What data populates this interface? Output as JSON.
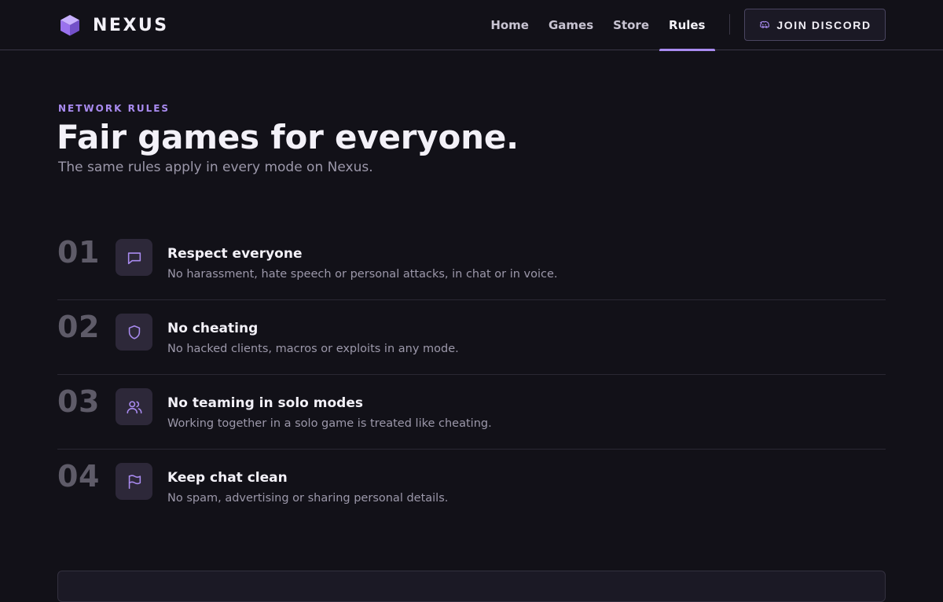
{
  "brand": {
    "name": "NEXUS",
    "accent": "#a98bf0"
  },
  "nav": {
    "items": [
      {
        "label": "Home",
        "active": false
      },
      {
        "label": "Games",
        "active": false
      },
      {
        "label": "Store",
        "active": false
      },
      {
        "label": "Rules",
        "active": true
      }
    ],
    "cta_label": "JOIN DISCORD",
    "cta_icon": "discord-icon"
  },
  "hero": {
    "eyebrow": "NETWORK RULES",
    "title": "Fair games for everyone.",
    "subtitle": "The same rules apply in every mode on Nexus."
  },
  "rules": [
    {
      "number": "01",
      "icon": "chat-bubble-icon",
      "title": "Respect everyone",
      "description": "No harassment, hate speech or personal attacks, in chat or in voice."
    },
    {
      "number": "02",
      "icon": "shield-icon",
      "title": "No cheating",
      "description": "No hacked clients, macros or exploits in any mode."
    },
    {
      "number": "03",
      "icon": "users-icon",
      "title": "No teaming in solo modes",
      "description": "Working together in a solo game is treated like cheating."
    },
    {
      "number": "04",
      "icon": "flag-icon",
      "title": "Keep chat clean",
      "description": "No spam, advertising or sharing personal details."
    }
  ]
}
